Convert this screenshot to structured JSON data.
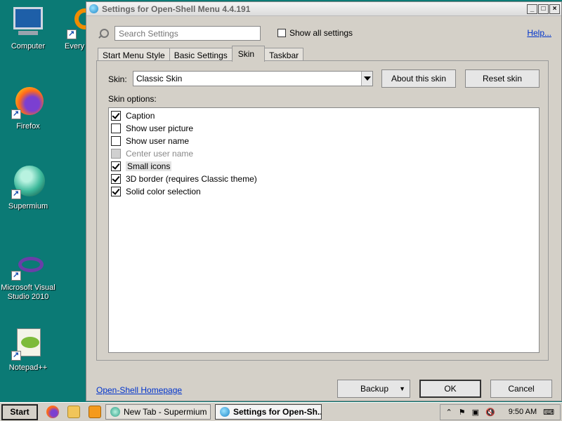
{
  "desktop": {
    "icons": [
      {
        "label": "Computer"
      },
      {
        "label": "Every"
      },
      {
        "label": "Firefox"
      },
      {
        "label": "Supermium"
      },
      {
        "label": "Microsoft Visual Studio 2010"
      },
      {
        "label": "Notepad++"
      }
    ]
  },
  "window": {
    "title": "Settings for Open-Shell Menu 4.4.191",
    "search": {
      "placeholder": "Search Settings",
      "value": ""
    },
    "show_all_label": "Show all settings",
    "show_all_checked": false,
    "help_label": "Help...",
    "tabs": [
      {
        "label": "Start Menu Style",
        "active": false
      },
      {
        "label": "Basic Settings",
        "active": false
      },
      {
        "label": "Skin",
        "active": true
      },
      {
        "label": "Taskbar",
        "active": false
      }
    ],
    "skin": {
      "label": "Skin:",
      "selected": "Classic Skin",
      "about_button": "About this skin",
      "reset_button": "Reset skin",
      "options_label": "Skin options:",
      "options": [
        {
          "label": "Caption",
          "checked": true,
          "enabled": true
        },
        {
          "label": "Show user picture",
          "checked": false,
          "enabled": true
        },
        {
          "label": "Show user name",
          "checked": false,
          "enabled": true
        },
        {
          "label": "Center user name",
          "checked": false,
          "enabled": false
        },
        {
          "label": "Small icons",
          "checked": true,
          "enabled": true,
          "selected": true
        },
        {
          "label": "3D border (requires Classic theme)",
          "checked": true,
          "enabled": true
        },
        {
          "label": "Solid color selection",
          "checked": true,
          "enabled": true
        }
      ]
    },
    "footer": {
      "homepage_link": "Open-Shell Homepage",
      "backup_button": "Backup",
      "ok_button": "OK",
      "cancel_button": "Cancel"
    }
  },
  "taskbar": {
    "start_label": "Start",
    "items": [
      {
        "label": "New Tab - Supermium",
        "active": false
      },
      {
        "label": "Settings for Open-Sh...",
        "active": true
      }
    ],
    "clock": "9:50 AM"
  }
}
